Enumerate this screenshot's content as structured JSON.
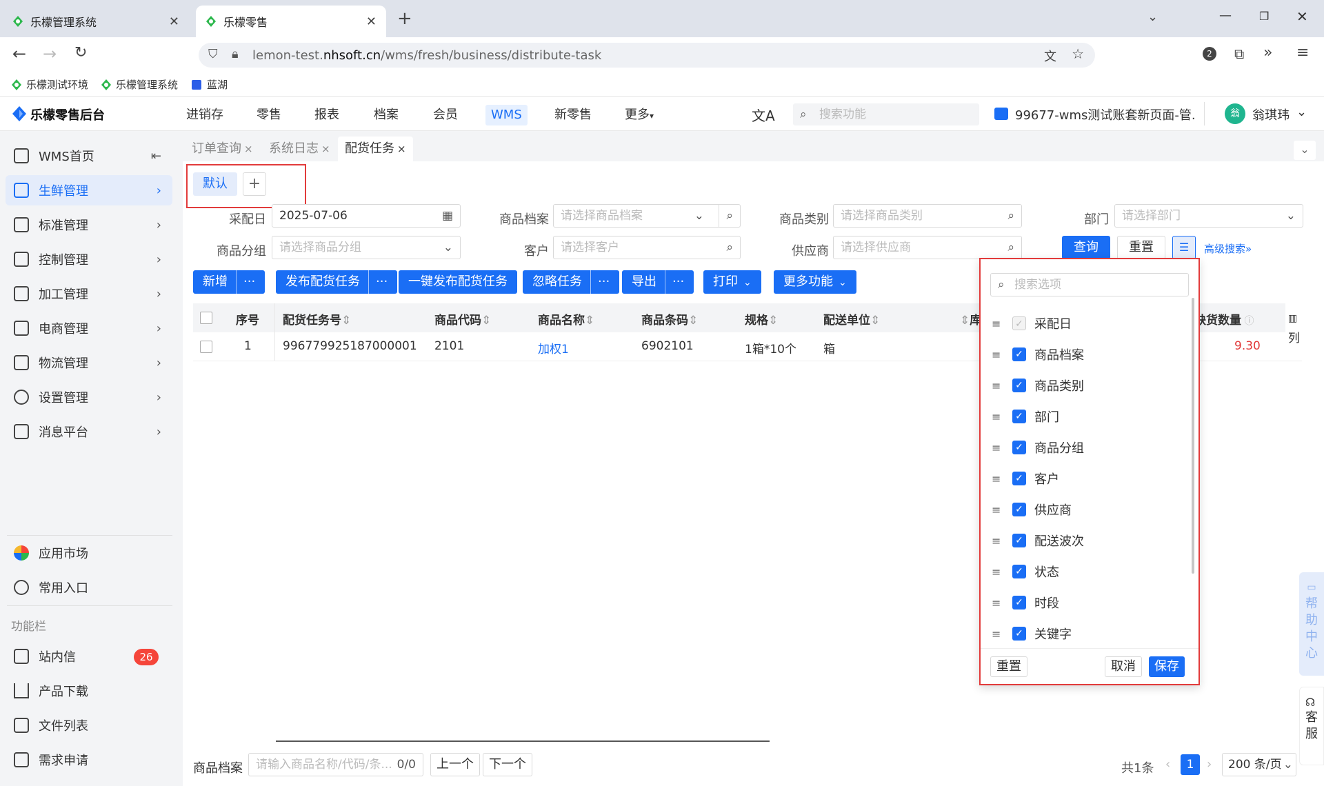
{
  "browser": {
    "tabs": [
      {
        "title": "乐檬管理系统",
        "active": false
      },
      {
        "title": "乐檬零售",
        "active": true
      }
    ],
    "new_tab": "+",
    "url_prefix": "lemon-test.",
    "url_domain": "nhsoft.cn",
    "url_path": "/wms/fresh/business/distribute-task",
    "profile_badge": "2",
    "bookmarks": [
      "乐檬测试环境",
      "乐檬管理系统",
      "蓝湖"
    ]
  },
  "app": {
    "logo_text": "乐檬零售后台",
    "nav": [
      "进销存",
      "零售",
      "报表",
      "档案",
      "会员",
      "WMS",
      "新零售",
      "更多"
    ],
    "nav_active": "WMS",
    "search_placeholder": "搜索功能",
    "account": "99677-wms测试账套新页面-管...",
    "avatar_char": "翁",
    "user_name": "翁琪玮"
  },
  "sidebar": {
    "items": [
      {
        "label": "WMS首页"
      },
      {
        "label": "生鲜管理",
        "active": true
      },
      {
        "label": "标准管理"
      },
      {
        "label": "控制管理"
      },
      {
        "label": "加工管理"
      },
      {
        "label": "电商管理"
      },
      {
        "label": "物流管理"
      },
      {
        "label": "设置管理"
      },
      {
        "label": "消息平台"
      }
    ],
    "bottom_items": [
      {
        "label": "应用市场"
      },
      {
        "label": "常用入口"
      }
    ],
    "section_title": "功能栏",
    "func_items": [
      {
        "label": "站内信",
        "badge": "26"
      },
      {
        "label": "产品下载"
      },
      {
        "label": "文件列表"
      },
      {
        "label": "需求申请"
      }
    ]
  },
  "page_tabs": [
    {
      "label": "订单查询",
      "close": "×"
    },
    {
      "label": "系统日志",
      "close": "×"
    },
    {
      "label": "配货任务",
      "close": "×",
      "active": true
    }
  ],
  "scheme": {
    "default": "默认",
    "add": "+"
  },
  "filters": {
    "date_label": "采配日",
    "date_value": "2025-07-06",
    "goods_label": "商品档案",
    "goods_placeholder": "请选择商品档案",
    "category_label": "商品类别",
    "category_placeholder": "请选择商品类别",
    "dept_label": "部门",
    "dept_placeholder": "请选择部门",
    "group_label": "商品分组",
    "group_placeholder": "请选择商品分组",
    "customer_label": "客户",
    "customer_placeholder": "请选择客户",
    "supplier_label": "供应商",
    "supplier_placeholder": "请选择供应商",
    "query": "查询",
    "reset": "重置",
    "advanced": "高级搜索"
  },
  "toolbar": {
    "add": "新增",
    "publish": "发布配货任务",
    "one_click": "一键发布配货任务",
    "ignore": "忽略任务",
    "export": "导出",
    "print": "打印",
    "more": "更多功能",
    "dots": "···"
  },
  "table": {
    "columns": [
      "序号",
      "配货任务号",
      "商品代码",
      "商品名称",
      "商品条码",
      "规格",
      "配送单位",
      "库",
      "缺货数量"
    ],
    "column_setting": "列",
    "rows": [
      {
        "idx": "1",
        "task_no": "996779925187000001",
        "code": "2101",
        "name": "加权1",
        "barcode": "6902101",
        "spec": "1箱*10个",
        "unit": "箱",
        "short_qty": "9.30"
      }
    ]
  },
  "column_popover": {
    "search_placeholder": "搜索选项",
    "options": [
      {
        "label": "采配日",
        "disabled": true
      },
      {
        "label": "商品档案"
      },
      {
        "label": "商品类别"
      },
      {
        "label": "部门"
      },
      {
        "label": "商品分组"
      },
      {
        "label": "客户"
      },
      {
        "label": "供应商"
      },
      {
        "label": "配送波次"
      },
      {
        "label": "状态"
      },
      {
        "label": "时段"
      },
      {
        "label": "关键字"
      }
    ],
    "reset": "重置",
    "cancel": "取消",
    "save": "保存"
  },
  "footer": {
    "goods_label": "商品档案",
    "goods_placeholder": "请输入商品名称/代码/条...",
    "count": "0/0",
    "prev": "上一个",
    "next": "下一个",
    "total": "共1条",
    "page": "1",
    "page_size": "200 条/页"
  },
  "float": {
    "help": "帮助中心",
    "service": "客服"
  },
  "colors": {
    "primary": "#1a6ef5",
    "highlight_border": "#e23b3b",
    "badge": "#f5453a",
    "short_qty": "#e23b3b"
  }
}
